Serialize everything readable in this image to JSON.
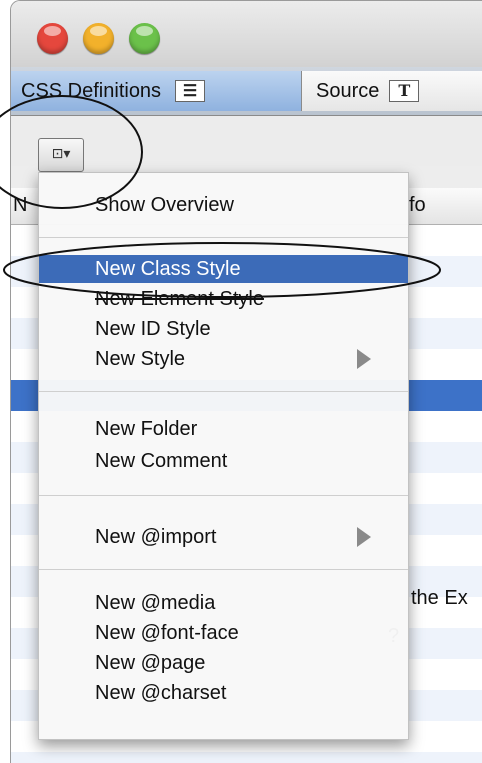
{
  "window": {
    "traffic_colors": [
      "#e5473d",
      "#f2b12b",
      "#6bc14a"
    ]
  },
  "tabs": [
    {
      "label": "CSS Definitions",
      "icon": "list-icon",
      "icon_glyph": "☰",
      "active": true
    },
    {
      "label": "Source",
      "icon": "text-icon",
      "icon_glyph": "T",
      "active": false
    }
  ],
  "toolbar": {
    "menu_button_icon": "add-style-icon",
    "menu_button_glyph": "⊡▾"
  },
  "list": {
    "header_visible_fragment": "fo",
    "name_header_fragment": "N",
    "row_fragment_a": "the Ex",
    "row_fragment_b": "?"
  },
  "menu": {
    "items": [
      {
        "label": "Show Overview"
      },
      {
        "label": "New Class Style",
        "highlighted": true
      },
      {
        "label": "New Element Style"
      },
      {
        "label": "New ID Style"
      },
      {
        "label": "New Style",
        "submenu": true
      },
      {
        "label": "New Folder"
      },
      {
        "label": "New Comment"
      },
      {
        "label": "New @import",
        "submenu": true
      },
      {
        "label": "New @media"
      },
      {
        "label": "New @font-face"
      },
      {
        "label": "New @page"
      },
      {
        "label": "New @charset"
      }
    ]
  }
}
